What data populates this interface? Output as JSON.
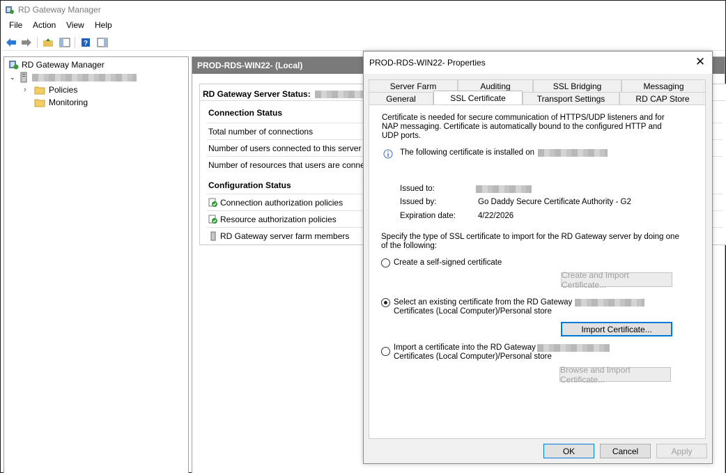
{
  "window": {
    "title": "RD Gateway Manager",
    "menu": [
      "File",
      "Action",
      "View",
      "Help"
    ]
  },
  "tree": {
    "root": "RD Gateway Manager",
    "children": [
      "Policies",
      "Monitoring"
    ]
  },
  "center": {
    "header": "PROD-RDS-WIN22- (Local)",
    "status_title": "RD Gateway Server Status:",
    "connection_status": "Connection Status",
    "connection_rows": [
      "Total number of connections",
      "Number of users connected to this server",
      "Number of resources that users are conne"
    ],
    "configuration_status": "Configuration Status",
    "config_rows": [
      "Connection authorization policies",
      "Resource authorization policies",
      "RD Gateway server farm members"
    ]
  },
  "dialog": {
    "title": "PROD-RDS-WIN22- Properties",
    "tabs_row1": [
      "Server Farm",
      "Auditing",
      "SSL Bridging",
      "Messaging"
    ],
    "tabs_row2": [
      "General",
      "SSL Certificate",
      "Transport Settings",
      "RD CAP Store"
    ],
    "active_tab": "SSL Certificate",
    "intro": "Certificate is needed for secure communication of HTTPS/UDP listeners and for NAP messaging. Certificate is automatically bound to the configured HTTP and UDP ports.",
    "installed_on": "The following certificate is installed on",
    "issued_to_label": "Issued to:",
    "issued_by_label": "Issued by:",
    "issued_by": "Go Daddy Secure Certificate Authority - G2",
    "expiration_label": "Expiration date:",
    "expiration": "4/22/2026",
    "specify_text": "Specify the type of SSL certificate to import for the RD Gateway server by doing one of the following:",
    "option1": "Create a self-signed certificate",
    "option1_button": "Create and Import Certificate...",
    "option2_line1": "Select an existing certificate from the RD Gateway",
    "option2_line2": "Certificates (Local Computer)/Personal store",
    "option2_button": "Import Certificate...",
    "option3_line1": "Import a certificate into the RD Gateway",
    "option3_line2": "Certificates (Local Computer)/Personal store",
    "option3_button": "Browse and Import Certificate...",
    "selected_option": 2,
    "ok": "OK",
    "cancel": "Cancel",
    "apply": "Apply"
  }
}
